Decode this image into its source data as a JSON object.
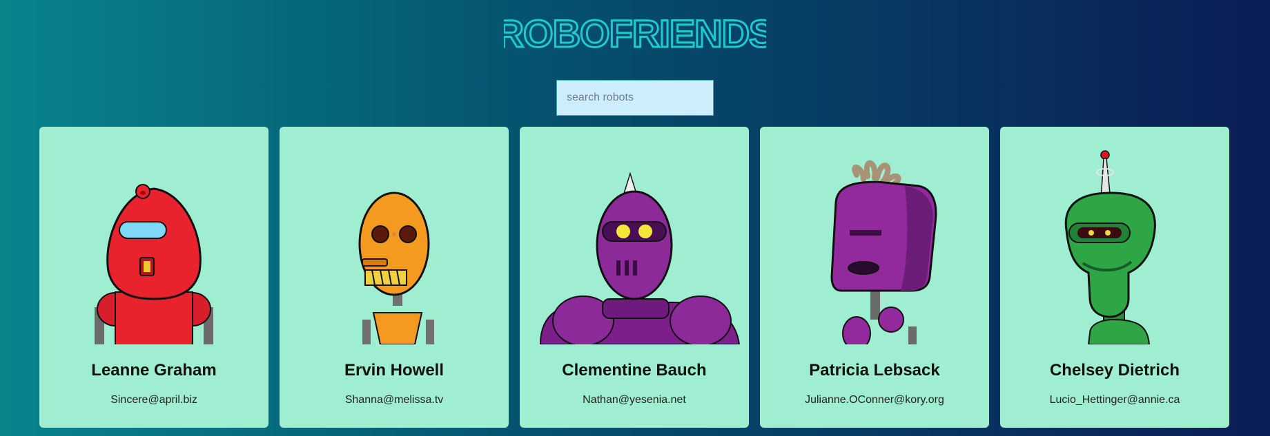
{
  "app": {
    "title": "ROBOFRIENDS"
  },
  "search": {
    "placeholder": "search robots",
    "value": ""
  },
  "robots": [
    {
      "name": "Leanne Graham",
      "email": "Sincere@april.biz",
      "color": "#e8232e",
      "icon": "red-robot"
    },
    {
      "name": "Ervin Howell",
      "email": "Shanna@melissa.tv",
      "color": "#f59a21",
      "icon": "orange-robot"
    },
    {
      "name": "Clementine Bauch",
      "email": "Nathan@yesenia.net",
      "color": "#8c2a9a",
      "icon": "purple-robot"
    },
    {
      "name": "Patricia Lebsack",
      "email": "Julianne.OConner@kory.org",
      "color": "#922a9d",
      "icon": "purple-box-robot"
    },
    {
      "name": "Chelsey Dietrich",
      "email": "Lucio_Hettinger@annie.ca",
      "color": "#2fa646",
      "icon": "green-robot"
    }
  ],
  "colors": {
    "accent": "#1ec9d0",
    "card": "#9feed2",
    "search_bg": "#cfeefd"
  }
}
